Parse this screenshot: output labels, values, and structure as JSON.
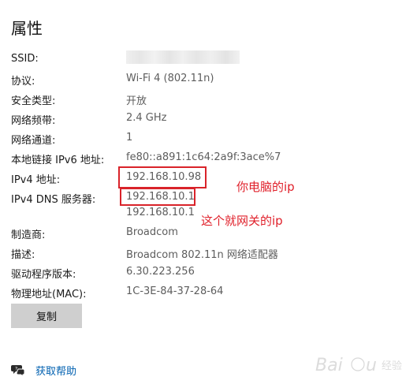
{
  "title": "属性",
  "properties": [
    {
      "label": "SSID:",
      "value": ""
    },
    {
      "label": "协议:",
      "value": "Wi-Fi 4 (802.11n)"
    },
    {
      "label": "安全类型:",
      "value": "开放"
    },
    {
      "label": "网络频带:",
      "value": "2.4 GHz"
    },
    {
      "label": "网络通道:",
      "value": "1"
    },
    {
      "label": "本地链接 IPv6 地址:",
      "value": "fe80::a891:1c64:2a9f:3ace%7"
    },
    {
      "label": "IPv4 地址:",
      "value": "192.168.10.98"
    },
    {
      "label": "IPv4 DNS 服务器:",
      "value": "192.168.10.1",
      "value2": "192.168.10.1"
    },
    {
      "label": "制造商:",
      "value": "Broadcom"
    },
    {
      "label": "描述:",
      "value": "Broadcom 802.11n 网络适配器"
    },
    {
      "label": "驱动程序版本:",
      "value": "6.30.223.256"
    },
    {
      "label": "物理地址(MAC):",
      "value": "1C-3E-84-37-28-64"
    }
  ],
  "annotations": {
    "ipv4_note": "你电脑的ip",
    "dns_note": "这个就网关的ip",
    "box_color": "#d9232a"
  },
  "copy_button": "复制",
  "help_link": "获取帮助",
  "watermark": "Baidu 经验",
  "colors": {
    "link": "#0060b0",
    "annotation": "#e0212b"
  }
}
